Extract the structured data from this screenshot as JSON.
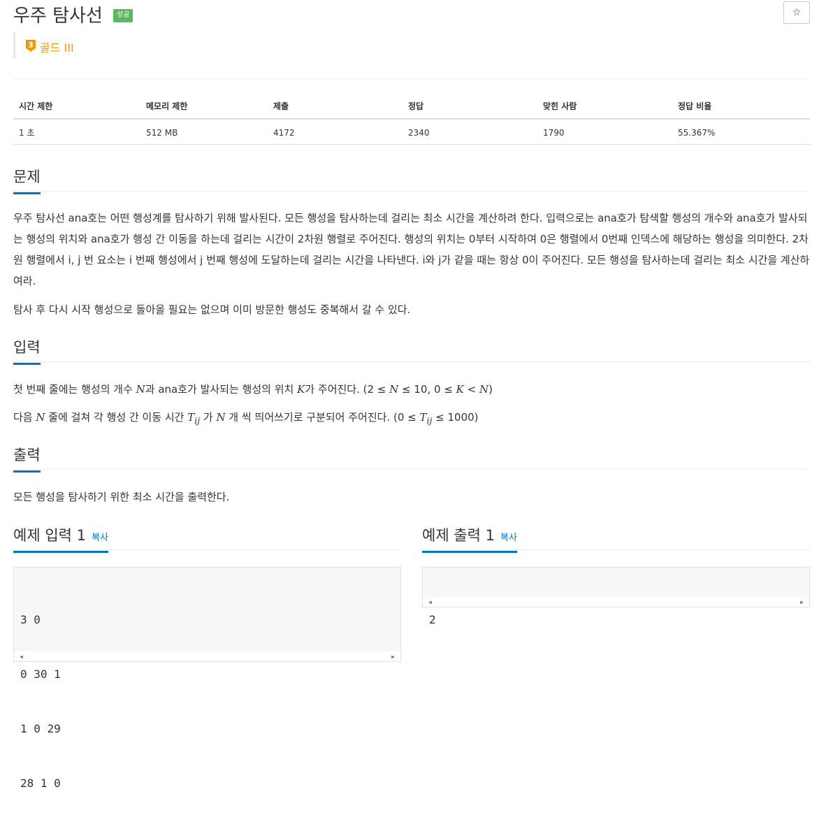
{
  "problem": {
    "title": "우주 탐사선",
    "status_badge": "성공",
    "star_icon": "☆",
    "tier_number": "3",
    "tier_label": "골드 III"
  },
  "info_table": {
    "headers": [
      "시간 제한",
      "메모리 제한",
      "제출",
      "정답",
      "맞힌 사람",
      "정답 비율"
    ],
    "values": [
      "1 초",
      "512 MB",
      "4172",
      "2340",
      "1790",
      "55.367%"
    ]
  },
  "description": {
    "heading": "문제",
    "p1": "우주 탐사선 ana호는 어떤 행성계를 탐사하기 위해 발사된다. 모든 행성을 탐사하는데 걸리는 최소 시간을 계산하려 한다. 입력으로는 ana호가 탐색할 행성의 개수와 ana호가 발사되는 행성의 위치와 ana호가 행성 간 이동을 하는데 걸리는 시간이 2차원 행렬로 주어진다. 행성의 위치는 0부터 시작하여 0은 행렬에서 0번째 인덱스에 해당하는 행성을 의미한다. 2차원 행렬에서 i, j 번 요소는 i 번째 행성에서 j 번째 행성에 도달하는데 걸리는 시간을 나타낸다. i와 j가 같을 때는 항상 0이 주어진다. 모든 행성을 탐사하는데 걸리는 최소 시간을 계산하여라.",
    "p2": "탐사 후 다시 시작 행성으로 돌아올 필요는 없으며 이미 방문한 행성도 중복해서 갈 수 있다."
  },
  "input": {
    "heading": "입력",
    "l1_a": "첫 번째 줄에는 행성의 개수 ",
    "l1_n": "N",
    "l1_b": "과 ana호가 발사되는 행성의 위치 ",
    "l1_k": "K",
    "l1_c": "가 주어진다. (2 ≤ ",
    "l1_n2": "N",
    "l1_d": " ≤ 10, 0 ≤ ",
    "l1_k2": "K",
    "l1_e": " < ",
    "l1_n3": "N",
    "l1_f": ")",
    "l2_a": "다음 ",
    "l2_n": "N",
    "l2_b": " 줄에 걸쳐 각 행성 간 이동 시간 ",
    "l2_t": "T",
    "l2_sub": "ij",
    "l2_c": " 가 ",
    "l2_n2": "N",
    "l2_d": " 개 씩 띄어쓰기로 구분되어 주어진다. (0 ≤ ",
    "l2_t2": "T",
    "l2_sub2": "ij",
    "l2_e": "  ≤ 1000)"
  },
  "output": {
    "heading": "출력",
    "text": "모든 행성을 탐사하기 위한 최소 시간을 출력한다."
  },
  "sample_input": {
    "heading": "예제 입력 1",
    "copy": "복사",
    "lines": [
      "3 0",
      "0 30 1",
      "1 0 29",
      "28 1 0"
    ]
  },
  "sample_output": {
    "heading": "예제 출력 1",
    "copy": "복사",
    "lines": [
      "2"
    ]
  },
  "colors": {
    "accent_blue": "#0076c0",
    "success_green": "#5cb85c",
    "gold": "#ec9a00"
  }
}
